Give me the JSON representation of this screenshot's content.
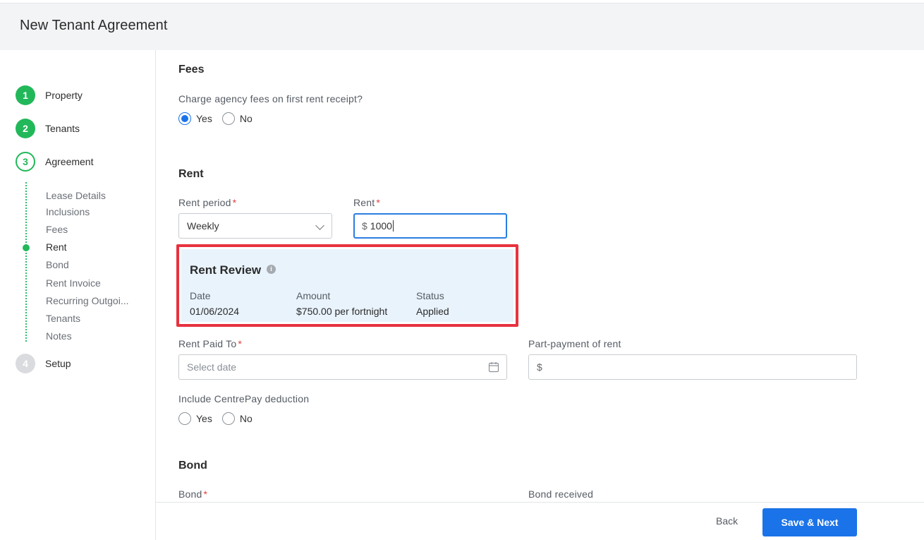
{
  "header": {
    "title": "New Tenant Agreement"
  },
  "sidebar": {
    "steps": [
      {
        "number": "1",
        "label": "Property"
      },
      {
        "number": "2",
        "label": "Tenants"
      },
      {
        "number": "3",
        "label": "Agreement"
      },
      {
        "number": "4",
        "label": "Setup"
      }
    ],
    "substeps": [
      "Lease Details",
      "Inclusions",
      "Fees",
      "Rent",
      "Bond",
      "Rent Invoice",
      "Recurring Outgoi...",
      "Tenants",
      "Notes"
    ],
    "active_substep": "Rent"
  },
  "fees": {
    "title": "Fees",
    "question": "Charge agency fees on first rent receipt?",
    "yes_label": "Yes",
    "no_label": "No",
    "selected": "Yes"
  },
  "rent": {
    "title": "Rent",
    "period_label": "Rent period",
    "period_value": "Weekly",
    "rent_label": "Rent",
    "currency": "$",
    "rent_value": "1000",
    "required_mark": "*"
  },
  "rent_review": {
    "title": "Rent Review",
    "info_icon": "i",
    "headers": {
      "date": "Date",
      "amount": "Amount",
      "status": "Status"
    },
    "values": {
      "date": "01/06/2024",
      "amount": "$750.00 per fortnight",
      "status": "Applied"
    },
    "highlight_color": "#e8323f"
  },
  "paid_to": {
    "label": "Rent Paid To",
    "placeholder": "Select date",
    "icon": "calendar-icon"
  },
  "part_payment": {
    "label": "Part-payment of rent",
    "currency": "$"
  },
  "centrepay": {
    "label": "Include CentrePay deduction",
    "yes_label": "Yes",
    "no_label": "No"
  },
  "bond": {
    "title": "Bond",
    "bond_label": "Bond",
    "received_label": "Bond received"
  },
  "footer": {
    "back_label": "Back",
    "save_label": "Save & Next"
  },
  "colors": {
    "accent": "#1a73e8",
    "success": "#22b85a"
  }
}
